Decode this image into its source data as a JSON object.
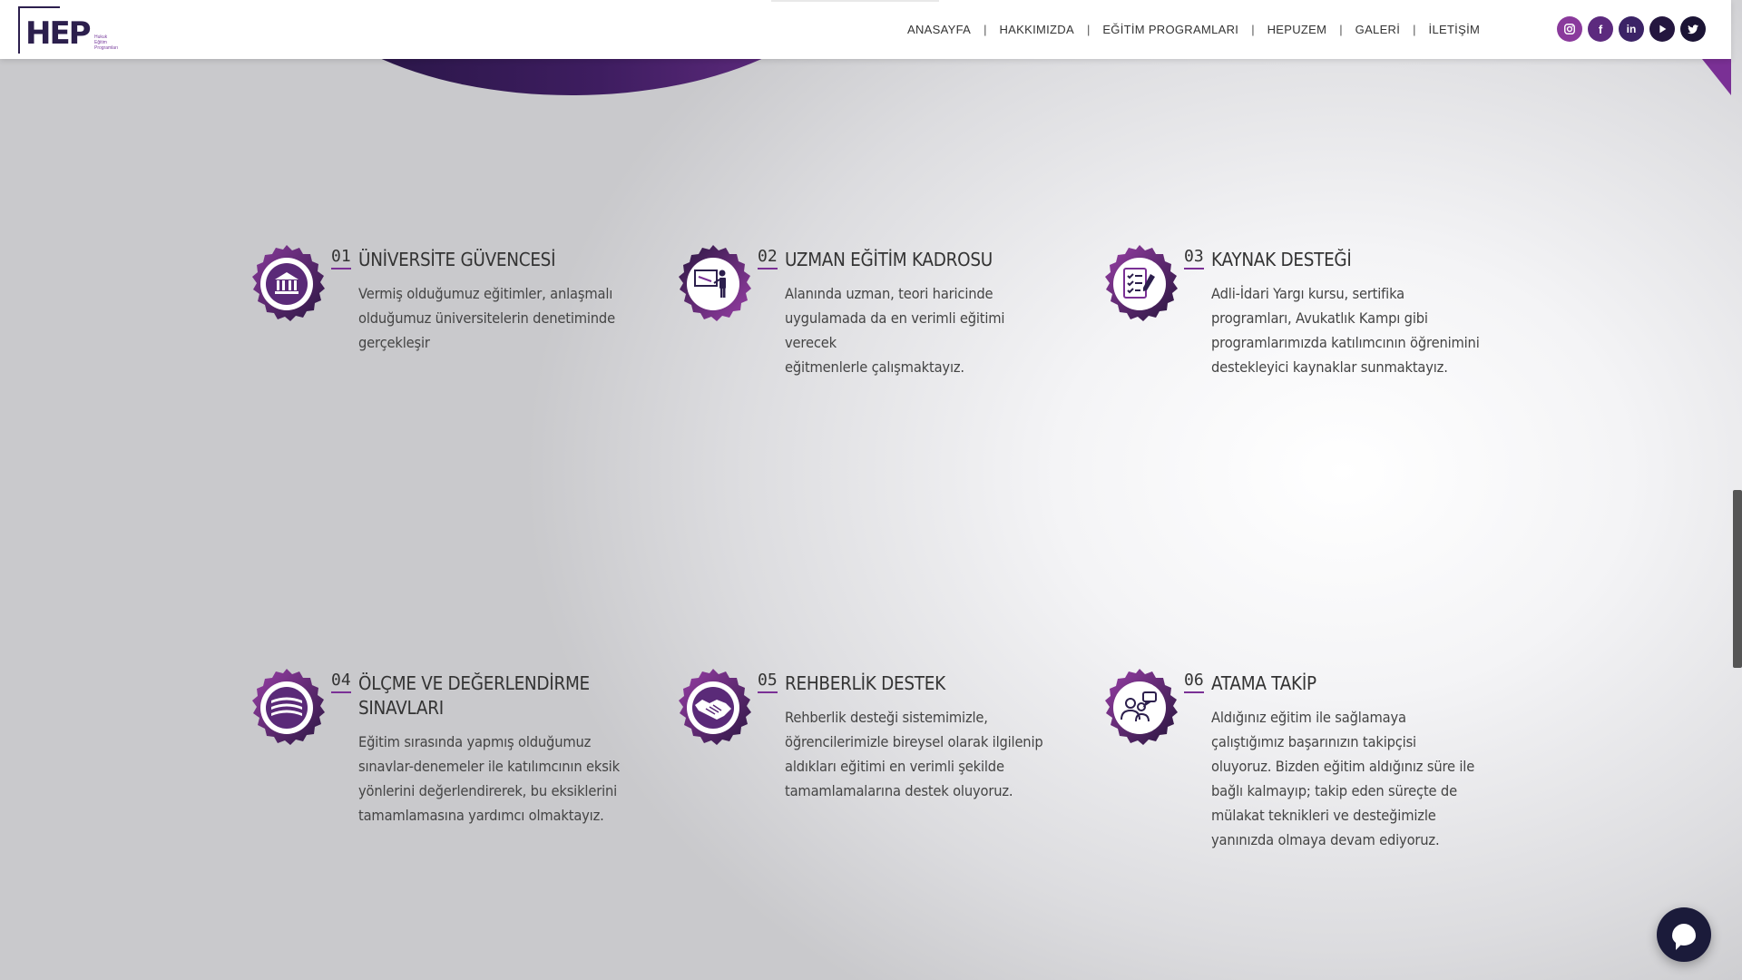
{
  "brand": {
    "logo_text": "HEP",
    "logo_sub": [
      "Hukuk",
      "Eğitim",
      "Programları"
    ]
  },
  "nav": {
    "items": [
      "ANASAYFA",
      "HAKKIMIZDA",
      "EĞİTİM PROGRAMLARI",
      "HEPUZEM",
      "GALERİ",
      "İLETİŞİM"
    ],
    "separator": "|"
  },
  "socials": [
    {
      "name": "instagram-icon",
      "color": "#8a3a9c"
    },
    {
      "name": "facebook-icon",
      "color": "#5c2a7e",
      "glyph": "f"
    },
    {
      "name": "linkedin-icon",
      "color": "#3b2366",
      "glyph": "in"
    },
    {
      "name": "youtube-icon",
      "color": "#24163f"
    },
    {
      "name": "twitter-icon",
      "color": "#1b1435"
    }
  ],
  "features": [
    {
      "num": "01",
      "title": "ÜNİVERSİTE GÜVENCESİ",
      "desc": [
        "Vermiş olduğumuz eğitimler, anlaşmalı",
        "olduğumuz üniversitelerin denetiminde",
        "gerçekleşir"
      ],
      "icon": "university-icon"
    },
    {
      "num": "02",
      "title": "UZMAN EĞİTİM KADROSU",
      "desc": [
        "Alanında uzman, teori haricinde",
        "uygulamada da en verimli eğitimi verecek",
        "eğitmenlerle çalışmaktayız."
      ],
      "icon": "teacher-icon"
    },
    {
      "num": "03",
      "title": "KAYNAK DESTEĞİ",
      "desc": [
        "Adli-İdari Yargı kursu, sertifika",
        "programları, Avukatlık Kampı gibi",
        "programlarımızda katılımcının öğrenimini",
        "destekleyici kaynaklar sunmaktayız."
      ],
      "icon": "checklist-icon"
    },
    {
      "num": "04",
      "title_lines": [
        "ÖLÇME VE DEĞERLENDİRME",
        "SINAVLARI"
      ],
      "desc": [
        "Eğitim sırasında yapmış olduğumuz",
        "sınavlar-denemeler ile katılımcının eksik",
        "yönlerini değerlendirerek, bu eksiklerini",
        "tamamlamasına yardımcı olmaktayız."
      ],
      "icon": "books-icon"
    },
    {
      "num": "05",
      "title": "REHBERLİK DESTEK",
      "desc": [
        "Rehberlik desteği sistemimizle,",
        "öğrencilerimizle bireysel olarak ilgilenip",
        "aldıkları eğitimi en verimli şekilde",
        "tamamlamalarına destek oluyoruz."
      ],
      "icon": "handshake-icon"
    },
    {
      "num": "06",
      "title": "ATAMA TAKİP",
      "desc": [
        "Aldığınız eğitim ile sağlamaya",
        "çalıştığımız başarınızın takipçisi",
        "oluyoruz. Bizden eğitim aldığınız süre ile",
        "bağlı kalmayıp; takip eden süreçte de",
        "mülakat teknikleri ve desteğimizle",
        "yanınızda olmaya devam ediyoruz."
      ],
      "icon": "people-chat-icon"
    }
  ],
  "colors": {
    "accent": "#7a3095",
    "dark": "#2c1f4d"
  }
}
